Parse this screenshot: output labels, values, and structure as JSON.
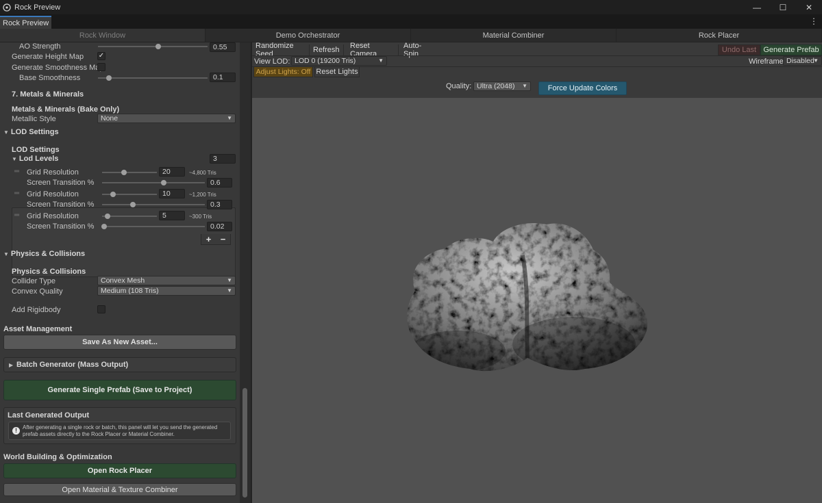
{
  "window": {
    "title": "Rock Preview",
    "minimize": "—",
    "maximize": "☐",
    "close": "✕"
  },
  "editor_tab": {
    "label": "Rock Preview",
    "menu": "⋮"
  },
  "window_tabs": [
    "Rock Window",
    "Demo Orchestrator",
    "Material Combiner",
    "Rock Placer"
  ],
  "left": {
    "ao_strength": {
      "label": "AO Strength",
      "value": "0.55",
      "level": 0.55
    },
    "generate_height_map": {
      "label": "Generate Height Map",
      "checked": true,
      "mark": "✓"
    },
    "generate_smoothness_map": {
      "label": "Generate Smoothness Map",
      "checked": false
    },
    "base_smoothness": {
      "label": "Base Smoothness",
      "value": "0.1",
      "level": 0.1
    },
    "section_metals": "7. Metals & Minerals",
    "metals_header": "Metals & Minerals (Bake Only)",
    "metallic_style": {
      "label": "Metallic Style",
      "value": "None"
    },
    "lod_foldout": "LOD Settings",
    "lod_header": "LOD Settings",
    "lod_levels": {
      "label": "Lod Levels",
      "value": "3"
    },
    "lods": [
      {
        "grid_label": "Grid Resolution",
        "grid_value": "20",
        "tris": "~4,800 Tris",
        "grid_level": 0.4,
        "trans_label": "Screen Transition %",
        "trans_value": "0.6",
        "trans_level": 0.6
      },
      {
        "grid_label": "Grid Resolution",
        "grid_value": "10",
        "tris": "~1,200 Tris",
        "grid_level": 0.2,
        "trans_label": "Screen Transition %",
        "trans_value": "0.3",
        "trans_level": 0.3
      },
      {
        "grid_label": "Grid Resolution",
        "grid_value": "5",
        "tris": "~300 Tris",
        "grid_level": 0.1,
        "trans_label": "Screen Transition %",
        "trans_value": "0.02",
        "trans_level": 0.02
      }
    ],
    "plus": "+",
    "minus": "−",
    "physics_foldout": "Physics & Collisions",
    "physics_header": "Physics & Collisions",
    "collider_type": {
      "label": "Collider Type",
      "value": "Convex Mesh"
    },
    "convex_quality": {
      "label": "Convex Quality",
      "value": "Medium (108 Tris)"
    },
    "add_rigidbody": {
      "label": "Add Rigidbody",
      "checked": false
    },
    "asset_management": "Asset Management",
    "save_as_new": "Save As New Asset...",
    "batch_generator": "Batch Generator (Mass Output)",
    "generate_single": "Generate Single Prefab (Save to Project)",
    "last_output_title": "Last Generated Output",
    "last_output_info": "After generating a single rock or batch, this panel will let you send the generated prefab assets directly to the Rock Placer or Material Combiner.",
    "info_icon": "!",
    "world_building": "World Building & Optimization",
    "open_rock_placer": "Open Rock Placer",
    "open_material_combiner": "Open Material & Texture Combiner"
  },
  "viewport": {
    "toolbar": [
      "Randomize Seed",
      "Refresh",
      "Reset Camera",
      "Auto-Spin"
    ],
    "undo_last": "Undo Last",
    "generate_prefab": "Generate Prefab",
    "view_lod_label": "View LOD:",
    "view_lod_value": "LOD 0 (19200 Tris)",
    "wireframe_label": "Wireframe:",
    "wireframe_value": "Disabled",
    "adjust_lights": "Adjust Lights: Off",
    "reset_lights": "Reset Lights",
    "quality_label": "Quality:",
    "quality_value": "Ultra (2048)",
    "force_update": "Force Update Colors"
  },
  "colors": {
    "accent_green": "#2c4a31",
    "accent_blue": "#25586e",
    "accent_orange": "#5b4514"
  }
}
